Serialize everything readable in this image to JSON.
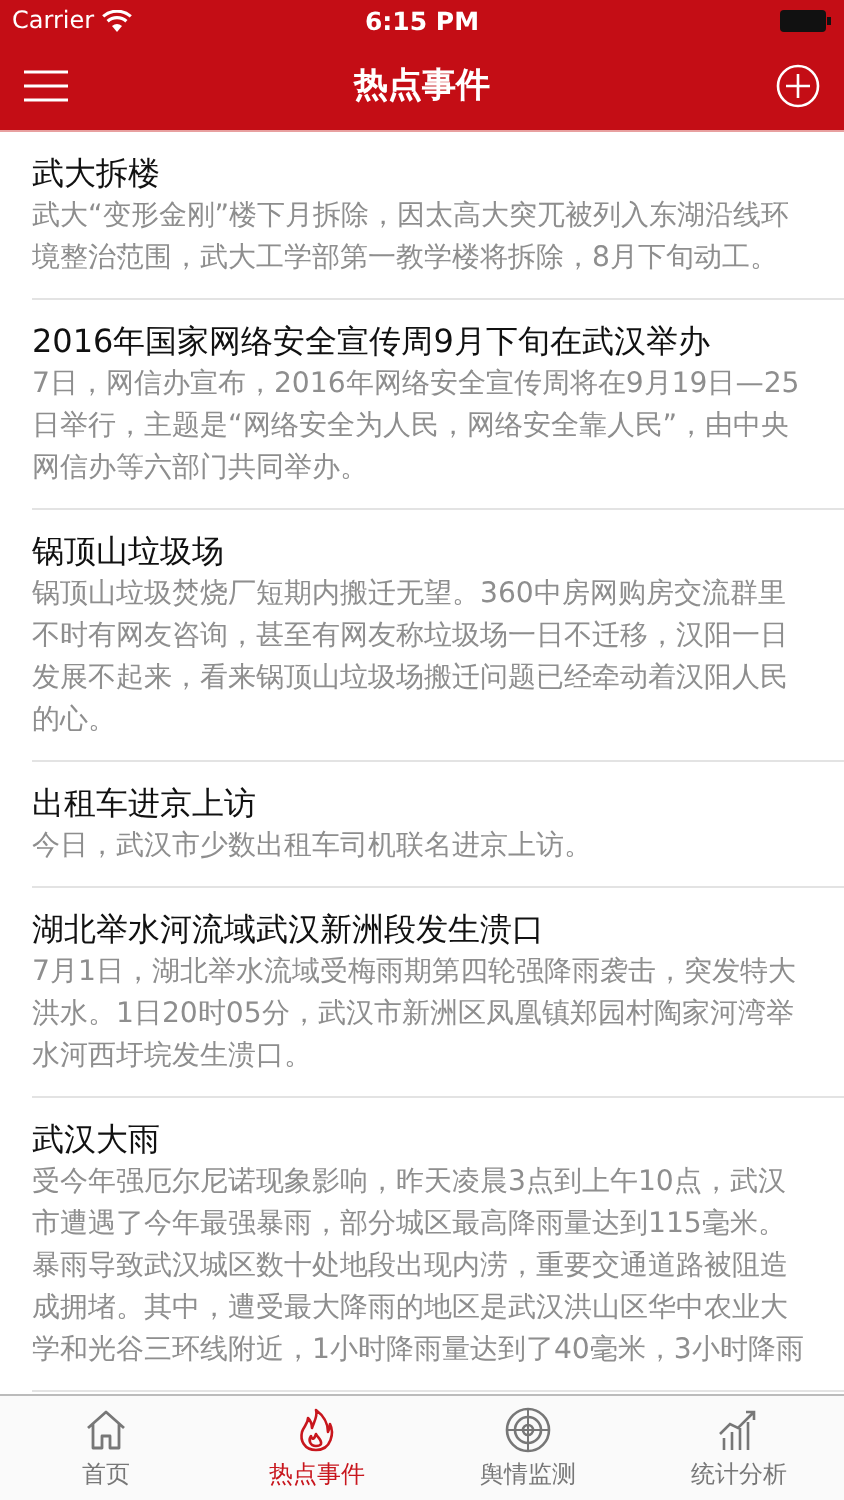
{
  "status_bar": {
    "carrier": "Carrier",
    "time": "6:15 PM"
  },
  "nav_bar": {
    "title": "热点事件"
  },
  "events": [
    {
      "title": "武大拆楼",
      "summary": "武大“变形金刚”楼下月拆除，因太高大突兀被列入东湖沿线环境整治范围，武大工学部第一教学楼将拆除，8月下旬动工。"
    },
    {
      "title": "2016年国家网络安全宣传周9月下旬在武汉举办",
      "summary": "7日，网信办宣布，2016年网络安全宣传周将在9月19日—25日举行，主题是“网络安全为人民，网络安全靠人民”，由中央网信办等六部门共同举办。"
    },
    {
      "title": "锅顶山垃圾场",
      "summary": "锅顶山垃圾焚烧厂短期内搬迁无望。360中房网购房交流群里不时有网友咨询，甚至有网友称垃圾场一日不迁移，汉阳一日发展不起来，看来锅顶山垃圾场搬迁问题已经牵动着汉阳人民的心。"
    },
    {
      "title": "出租车进京上访",
      "summary": "今日，武汉市少数出租车司机联名进京上访。"
    },
    {
      "title": "湖北举水河流域武汉新洲段发生溃口",
      "summary": "7月1日，湖北举水流域受梅雨期第四轮强降雨袭击，突发特大洪水。1日20时05分，武汉市新洲区凤凰镇郑园村陶家河湾举水河西圩垸发生溃口。"
    },
    {
      "title": "武汉大雨",
      "summary": "受今年强厄尔尼诺现象影响，昨天凌晨3点到上午10点，武汉市遭遇了今年最强暴雨，部分城区最高降雨量达到115毫米。暴雨导致武汉城区数十处地段出现内涝，重要交通道路被阻造成拥堵。其中，遭受最大降雨的地区是武汉洪山区华中农业大学和光谷三环线附近，1小时降雨量达到了40毫米，3小时降雨"
    }
  ],
  "tab_bar": [
    {
      "kind": "home",
      "label": "首页",
      "selected": false
    },
    {
      "kind": "fire",
      "label": "热点事件",
      "selected": true
    },
    {
      "kind": "target",
      "label": "舆情监测",
      "selected": false
    },
    {
      "kind": "chart",
      "label": "统计分析",
      "selected": false
    }
  ]
}
